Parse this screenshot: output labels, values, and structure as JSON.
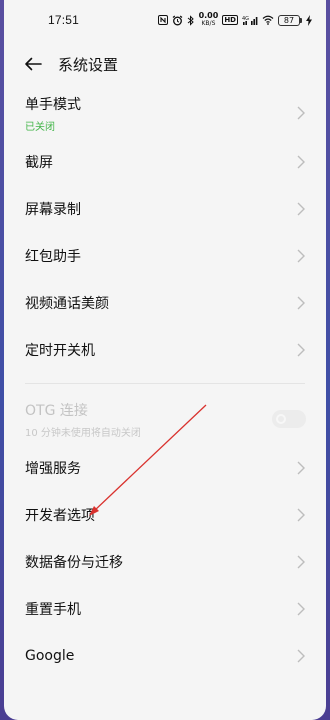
{
  "status_bar": {
    "time": "17:51",
    "net_speed": "0.00",
    "net_unit": "KB/S",
    "hd_label": "HD",
    "signal_label": "4G",
    "battery": "87"
  },
  "header": {
    "title": "系统设置"
  },
  "colors": {
    "accent_green": "#43b549",
    "annotation_red": "#d9322e"
  },
  "settings": {
    "one_hand": {
      "label": "单手模式",
      "status": "已关闭"
    },
    "screenshot": {
      "label": "截屏"
    },
    "screen_record": {
      "label": "屏幕录制"
    },
    "red_packet": {
      "label": "红包助手"
    },
    "video_beauty": {
      "label": "视频通话美颜"
    },
    "scheduled_power": {
      "label": "定时开关机"
    },
    "otg": {
      "label": "OTG 连接",
      "desc": "10 分钟未使用将自动关闭",
      "enabled": false
    },
    "enhanced": {
      "label": "增强服务"
    },
    "developer": {
      "label": "开发者选项"
    },
    "backup": {
      "label": "数据备份与迁移"
    },
    "reset": {
      "label": "重置手机"
    },
    "google": {
      "label": "Google"
    }
  }
}
